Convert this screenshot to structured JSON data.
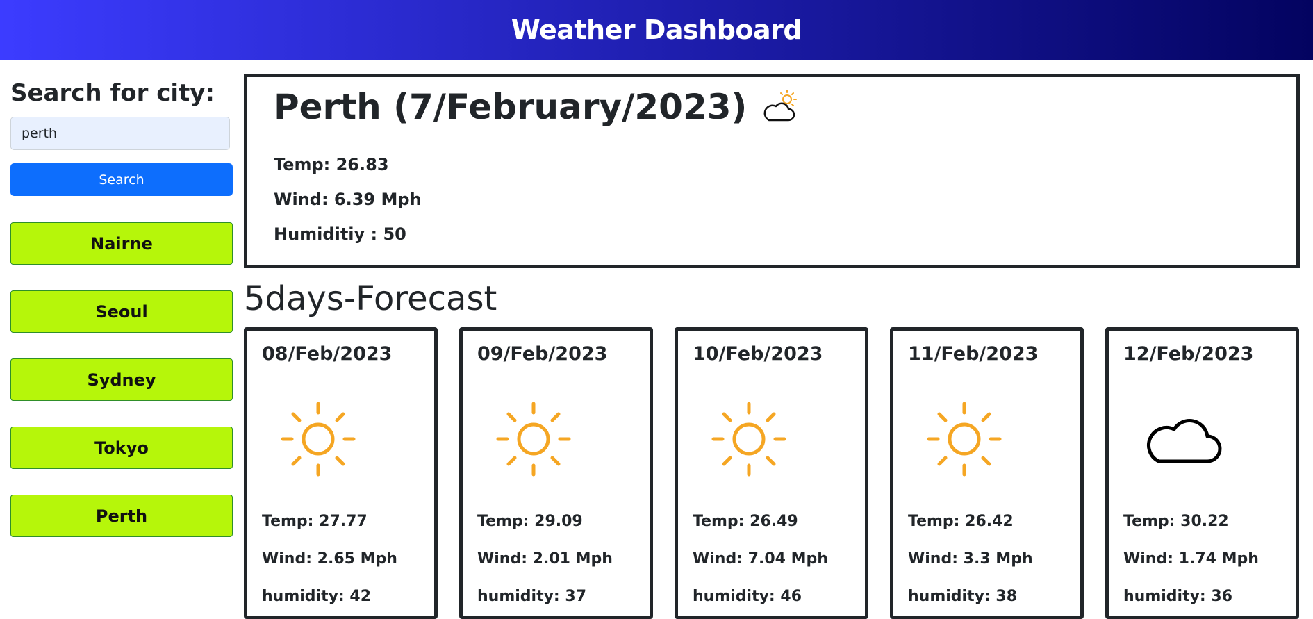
{
  "header": {
    "title": "Weather Dashboard"
  },
  "sidebar": {
    "heading": "Search for city:",
    "search_value": "perth",
    "search_button": "Search",
    "history": [
      "Nairne",
      "Seoul",
      "Sydney",
      "Tokyo",
      "Perth"
    ]
  },
  "current": {
    "title": "Perth (7/February/2023)",
    "icon": "partly-cloudy-icon",
    "temp": "Temp: 26.83",
    "wind": "Wind: 6.39 Mph",
    "humidity": "Humiditiy : 50"
  },
  "forecast": {
    "heading": "5days-Forecast",
    "days": [
      {
        "date": "08/Feb/2023",
        "icon": "sun-icon",
        "temp": "Temp: 27.77",
        "wind": "Wind: 2.65 Mph",
        "humidity": "humidity: 42"
      },
      {
        "date": "09/Feb/2023",
        "icon": "sun-icon",
        "temp": "Temp: 29.09",
        "wind": "Wind: 2.01 Mph",
        "humidity": "humidity: 37"
      },
      {
        "date": "10/Feb/2023",
        "icon": "sun-icon",
        "temp": "Temp: 26.49",
        "wind": "Wind: 7.04 Mph",
        "humidity": "humidity: 46"
      },
      {
        "date": "11/Feb/2023",
        "icon": "sun-icon",
        "temp": "Temp: 26.42",
        "wind": "Wind: 3.3 Mph",
        "humidity": "humidity: 38"
      },
      {
        "date": "12/Feb/2023",
        "icon": "cloud-icon",
        "temp": "Temp: 30.22",
        "wind": "Wind: 1.74 Mph",
        "humidity": "humidity: 36"
      }
    ]
  },
  "colors": {
    "header_gradient": [
      "#3c3cff",
      "#030360"
    ],
    "search_button": "#0d6efd",
    "history_button": "#b6f60a",
    "sun": "#f5a623",
    "card_border": "#212529"
  }
}
